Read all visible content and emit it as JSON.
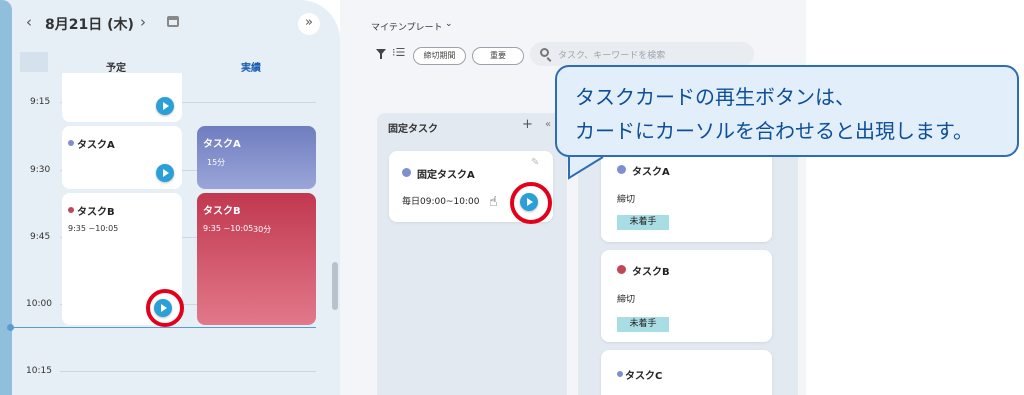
{
  "calendar": {
    "date": "8月21日 (木)",
    "prev_glyph": "‹",
    "next_glyph": "›",
    "collapse_glyph": "»",
    "col_planned": "予定",
    "col_actual": "実績",
    "times": [
      "9:15",
      "9:30",
      "9:45",
      "10:00",
      "10:15"
    ],
    "planned": [
      {
        "title": "タスクA",
        "dot_color": "#7d8fd1"
      },
      {
        "title": "タスクB",
        "time": "9:35 ~10:05",
        "dot_color": "#c0465a"
      }
    ],
    "actual": [
      {
        "title": "タスクA",
        "duration": "15分",
        "color": "#7f8bc9"
      },
      {
        "title": "タスクB",
        "time": "9:35 ~10:05",
        "duration": "30分",
        "color": "#c64358"
      }
    ]
  },
  "toolbar": {
    "template": "マイテンプレート",
    "chip1": "締切期間",
    "chip2": "重要",
    "search_placeholder": "タスク、キーワードを検索"
  },
  "fixed": {
    "header": "固定タスク",
    "add_glyph": "+",
    "collapse_glyph": "«",
    "card_title": "固定タスクA",
    "card_sub": "毎日09:00~10:00"
  },
  "tasks": [
    {
      "title": "タスクA",
      "label": "締切",
      "status": "未着手",
      "dot_color": "#7d8fd1"
    },
    {
      "title": "タスクB",
      "label": "締切",
      "status": "未着手",
      "dot_color": "#c0465a"
    },
    {
      "title": "タスクC",
      "dot_color": "#7d8fd1"
    }
  ],
  "callout": {
    "line1": "タスクカードの再生ボタンは、",
    "line2": "カードにカーソルを合わせると出現します。"
  },
  "colors": {
    "accent": "#2a9fd8",
    "highlight": "#e3001b",
    "callout_border": "#2e6db3"
  }
}
